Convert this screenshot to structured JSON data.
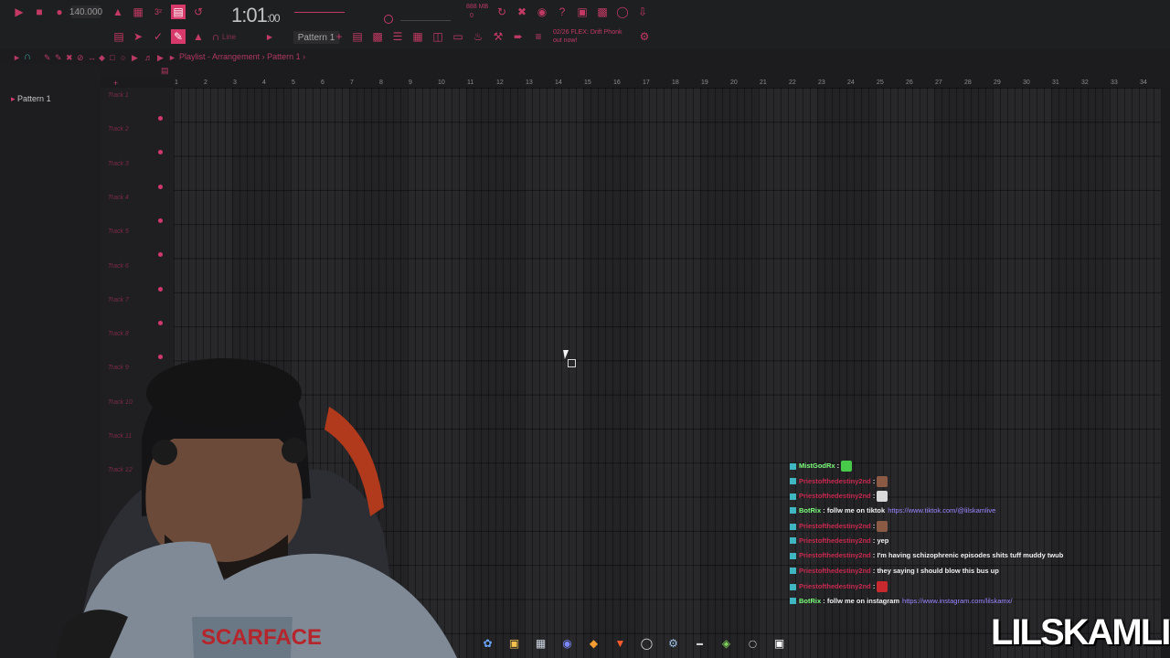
{
  "toolbar": {
    "tempo": "140.000",
    "song_position": "1:01",
    "song_position_ticks": "00",
    "pattern_name": "Pattern 1",
    "snap_label": "Line",
    "hint_line1": "02/26  FLEX: Drift Phonk",
    "hint_line2": "out now!",
    "memory": "888 MB",
    "cpu": "0"
  },
  "playlist": {
    "breadcrumb_title": "Playlist",
    "breadcrumb_sep1": "-",
    "breadcrumb_view": "Arrangement",
    "breadcrumb_sep2": "›",
    "breadcrumb_pattern": "Pattern 1",
    "breadcrumb_sep3": "›",
    "picker_pattern": "Pattern 1",
    "tracks": [
      "Track 1",
      "Track 2",
      "Track 3",
      "Track 4",
      "Track 5",
      "Track 6",
      "Track 7",
      "Track 8",
      "Track 9",
      "Track 10",
      "Track 11",
      "Track 12"
    ],
    "bar_numbers": [
      "1",
      "2",
      "3",
      "4",
      "5",
      "6",
      "7",
      "8",
      "9",
      "10",
      "11",
      "12",
      "13",
      "14",
      "15",
      "16",
      "17",
      "18",
      "19",
      "20",
      "21",
      "22",
      "23",
      "24",
      "25",
      "26",
      "27",
      "28",
      "29",
      "30",
      "31",
      "32",
      "33",
      "34"
    ]
  },
  "chat": [
    {
      "user": "MistGodRx",
      "user_color": "#7cff7c",
      "text": "",
      "emote": "green"
    },
    {
      "user": "Priestofthedestiny2nd",
      "user_color": "#c8294f",
      "text": "",
      "emote": "face"
    },
    {
      "user": "Priestofthedestiny2nd",
      "user_color": "#c8294f",
      "text": "",
      "emote": "figure"
    },
    {
      "user": "BotRix",
      "user_color": "#7cff7c",
      "text": "follw me on tiktok",
      "link": "https://www.tiktok.com/@lilskamlive"
    },
    {
      "user": "Priestofthedestiny2nd",
      "user_color": "#c8294f",
      "text": "",
      "emote": "face"
    },
    {
      "user": "Priestofthedestiny2nd",
      "user_color": "#c8294f",
      "text": "yep"
    },
    {
      "user": "Priestofthedestiny2nd",
      "user_color": "#c8294f",
      "text": "I'm having schizophrenic episodes shits tuff muddy twub"
    },
    {
      "user": "Priestofthedestiny2nd",
      "user_color": "#c8294f",
      "text": "they saying I should blow this bus up"
    },
    {
      "user": "Priestofthedestiny2nd",
      "user_color": "#c8294f",
      "text": "",
      "emote": "red"
    },
    {
      "user": "BotRix",
      "user_color": "#7cff7c",
      "text": "follw me on instagram",
      "link": "https://www.instagram.com/lilskamx/"
    }
  ],
  "watermark": "LILSKAMLIVE",
  "colors": {
    "accent": "#d7396a",
    "background": "#1b1b1d",
    "grid": "#232326"
  }
}
